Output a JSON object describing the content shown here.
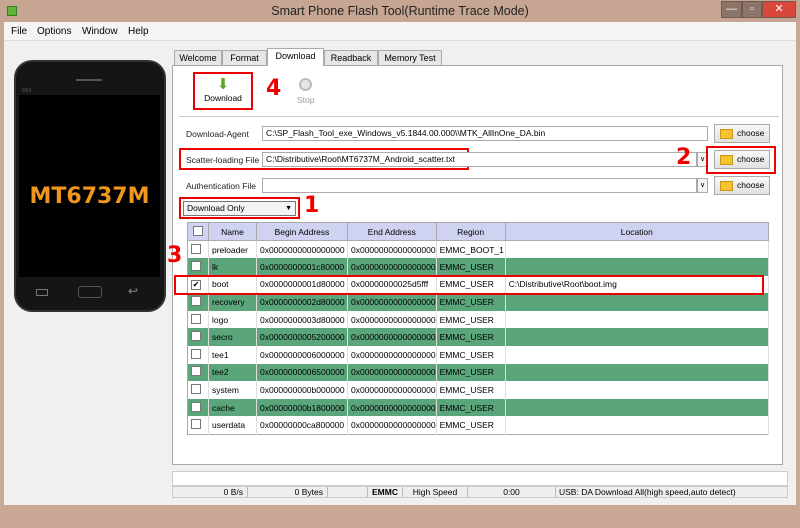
{
  "window": {
    "title": "Smart Phone Flash Tool(Runtime Trace Mode)",
    "controls": [
      "—",
      "▫",
      "✕"
    ]
  },
  "menu": [
    "File",
    "Options",
    "Window",
    "Help"
  ],
  "phone": {
    "chip": "MT6737M",
    "brand": "BM"
  },
  "tabs": [
    "Welcome",
    "Format",
    "Download",
    "Readback",
    "Memory Test"
  ],
  "toolbar": {
    "download": "Download",
    "stop": "Stop"
  },
  "annotations": {
    "n1": "1",
    "n2": "2",
    "n3": "3",
    "n4": "4"
  },
  "fields": {
    "download_agent": {
      "label": "Download-Agent",
      "value": "C:\\SP_Flash_Tool_exe_Windows_v5.1844.00.000\\\\MTK_AllInOne_DA.bin"
    },
    "scatter": {
      "label": "Scatter-loading File",
      "value": "C:\\Distributive\\Root\\MT6737M_Android_scatter.txt"
    },
    "auth": {
      "label": "Authentication File",
      "value": ""
    },
    "choose": "choose",
    "mode": "Download Only"
  },
  "table": {
    "headers": [
      "Name",
      "Begin Address",
      "End Address",
      "Region",
      "Location"
    ],
    "rows": [
      {
        "checked": false,
        "name": "preloader",
        "begin": "0x0000000000000000",
        "end": "0x0000000000000000",
        "region": "EMMC_BOOT_1",
        "location": ""
      },
      {
        "checked": false,
        "name": "lk",
        "begin": "0x0000000001c80000",
        "end": "0x0000000000000000",
        "region": "EMMC_USER",
        "location": ""
      },
      {
        "checked": true,
        "name": "boot",
        "begin": "0x0000000001d80000",
        "end": "0x00000000025d5fff",
        "region": "EMMC_USER",
        "location": "C:\\Distributive\\Root\\boot.img"
      },
      {
        "checked": false,
        "name": "recovery",
        "begin": "0x0000000002d80000",
        "end": "0x0000000000000000",
        "region": "EMMC_USER",
        "location": ""
      },
      {
        "checked": false,
        "name": "logo",
        "begin": "0x0000000003d80000",
        "end": "0x0000000000000000",
        "region": "EMMC_USER",
        "location": ""
      },
      {
        "checked": false,
        "name": "secro",
        "begin": "0x0000000005200000",
        "end": "0x0000000000000000",
        "region": "EMMC_USER",
        "location": ""
      },
      {
        "checked": false,
        "name": "tee1",
        "begin": "0x0000000006000000",
        "end": "0x0000000000000000",
        "region": "EMMC_USER",
        "location": ""
      },
      {
        "checked": false,
        "name": "tee2",
        "begin": "0x0000000006500000",
        "end": "0x0000000000000000",
        "region": "EMMC_USER",
        "location": ""
      },
      {
        "checked": false,
        "name": "system",
        "begin": "0x000000000b000000",
        "end": "0x0000000000000000",
        "region": "EMMC_USER",
        "location": ""
      },
      {
        "checked": false,
        "name": "cache",
        "begin": "0x00000000b1800000",
        "end": "0x0000000000000000",
        "region": "EMMC_USER",
        "location": ""
      },
      {
        "checked": false,
        "name": "userdata",
        "begin": "0x00000000ca800000",
        "end": "0x0000000000000000",
        "region": "EMMC_USER",
        "location": ""
      }
    ]
  },
  "status": {
    "speed": "0 B/s",
    "bytes": "0 Bytes",
    "storage": "EMMC",
    "mode": "High Speed",
    "time": "0:00",
    "usb": "USB: DA Download All(high speed,auto detect)"
  },
  "colors": {
    "highlight": "#5aa57a",
    "header": "#d0d2f2",
    "annotation": "#e00000"
  }
}
